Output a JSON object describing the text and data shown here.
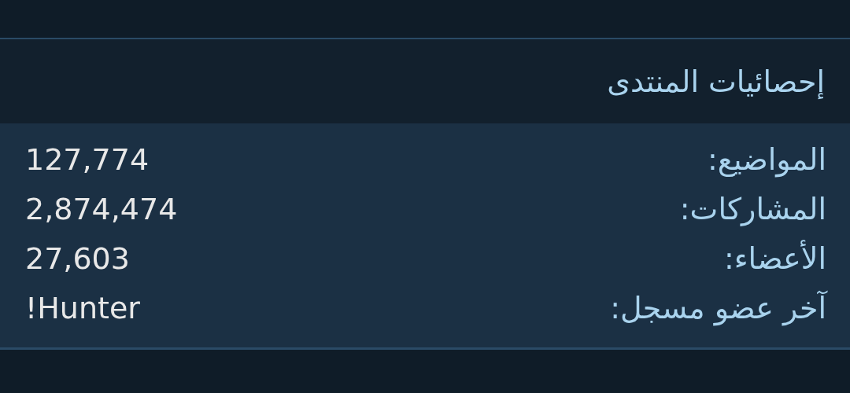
{
  "panel": {
    "title": "إحصائيات المنتدى",
    "stats": [
      {
        "label": "المواضيع:",
        "value": "127,774"
      },
      {
        "label": "المشاركات:",
        "value": "2,874,474"
      },
      {
        "label": "الأعضاء:",
        "value": "27,603"
      },
      {
        "label": "آخر عضو مسجل:",
        "value": "!Hunter"
      }
    ]
  }
}
